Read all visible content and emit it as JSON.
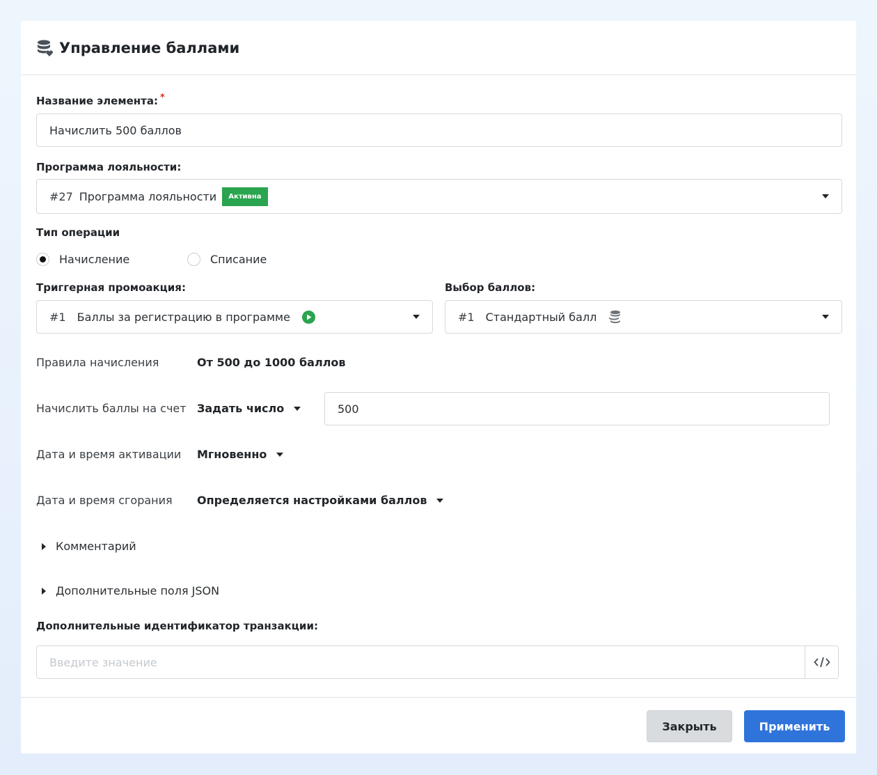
{
  "dialog": {
    "title": "Управление баллами",
    "title_icon": "database-heart-icon"
  },
  "form": {
    "name": {
      "label": "Название элемента:",
      "required_mark": "*",
      "value": "Начислить 500 баллов"
    },
    "program": {
      "label": "Программа лояльности:",
      "number": "#27",
      "value": "Программа лояльности",
      "badge": "Активна",
      "badge_color": "#2aa44f"
    },
    "operation": {
      "label": "Тип операции",
      "options": [
        {
          "label": "Начисление",
          "selected": true
        },
        {
          "label": "Списание",
          "selected": false
        }
      ]
    },
    "trigger": {
      "label": "Триггерная промоакция:",
      "number": "#1",
      "value": "Баллы за регистрацию в программе",
      "icon": "play-circle-icon",
      "icon_color": "#2aa44f"
    },
    "points_choice": {
      "label": "Выбор баллов:",
      "number": "#1",
      "value": "Стандартный балл",
      "icon": "coins-icon"
    },
    "rules": {
      "label": "Правила начисления",
      "value": "От 500 до 1000 баллов"
    },
    "accrue": {
      "label": "Начислить баллы на счет",
      "mode": "Задать число",
      "value": "500"
    },
    "activation": {
      "label": "Дата и время активации",
      "value": "Мгновенно"
    },
    "expiry": {
      "label": "Дата и время сгорания",
      "value": "Определяется настройками баллов"
    },
    "comment_toggle": "Комментарий",
    "json_toggle": "Дополнительные поля JSON",
    "transaction": {
      "label": "Дополнительные идентификатор транзакции:",
      "placeholder": "Введите значение",
      "code_icon": "code-icon"
    }
  },
  "footer": {
    "close_label": "Закрыть",
    "apply_label": "Применить",
    "apply_color": "#2f74db"
  }
}
